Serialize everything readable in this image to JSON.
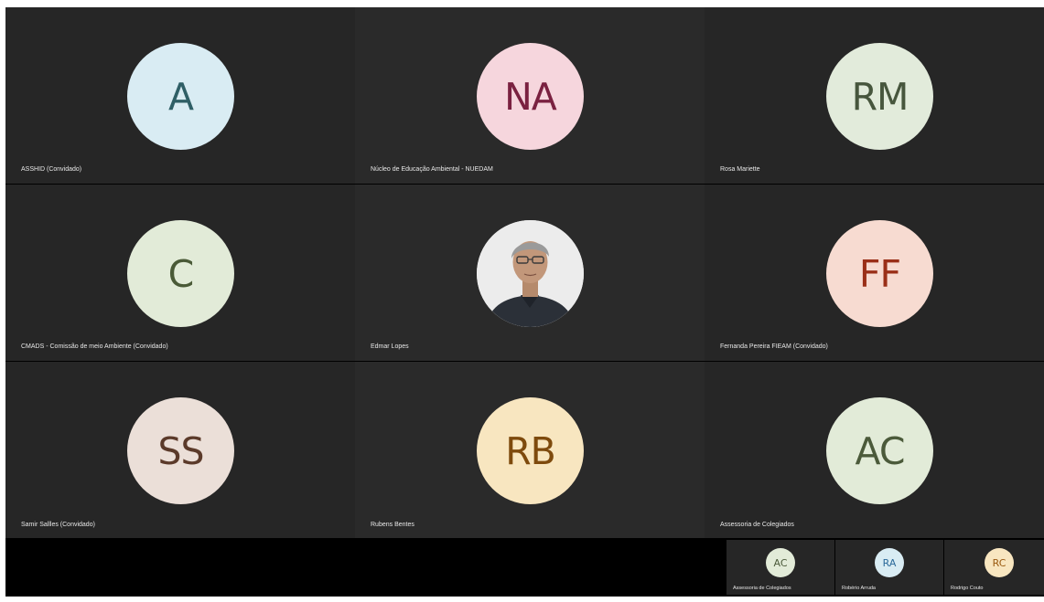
{
  "participants": [
    {
      "initials": "A",
      "name": "ASSHID (Convidado)",
      "bg": "#d9ecf3",
      "fg": "#2f5f66"
    },
    {
      "initials": "NA",
      "name": "Núcleo de Educação Ambiental - NUEDAM",
      "bg": "#f6d6dd",
      "fg": "#7a2140"
    },
    {
      "initials": "RM",
      "name": "Rosa Mariette",
      "bg": "#e2ebdb",
      "fg": "#47563d"
    },
    {
      "initials": "C",
      "name": "CMADS - Comissão de meio Ambiente (Convidado)",
      "bg": "#e2ebd8",
      "fg": "#4a5a37"
    },
    {
      "initials": "",
      "name": "Edmar Lopes",
      "photo": true
    },
    {
      "initials": "FF",
      "name": "Fernanda Pereira FIEAM (Convidado)",
      "bg": "#f7dbd1",
      "fg": "#9a2f18"
    },
    {
      "initials": "SS",
      "name": "Samir Sallles (Convidado)",
      "bg": "#ebdfd8",
      "fg": "#5b3a2a"
    },
    {
      "initials": "RB",
      "name": "Rubens Bentes",
      "bg": "#f8e6c0",
      "fg": "#7e4a0d"
    },
    {
      "initials": "AC",
      "name": "Assessoria de Colegiados",
      "bg": "#e2ebd8",
      "fg": "#4b5a3a"
    }
  ],
  "strip": [
    {
      "initials": "AC",
      "name": "Assessoria de Colegiados",
      "bg": "#e2ebd8",
      "fg": "#4b5a3a"
    },
    {
      "initials": "RA",
      "name": "Robério Arruda",
      "bg": "#d9ecf3",
      "fg": "#2c6a9a"
    },
    {
      "initials": "RC",
      "name": "Rodrigo Couto",
      "bg": "#f8e6c0",
      "fg": "#9a5a10"
    }
  ]
}
